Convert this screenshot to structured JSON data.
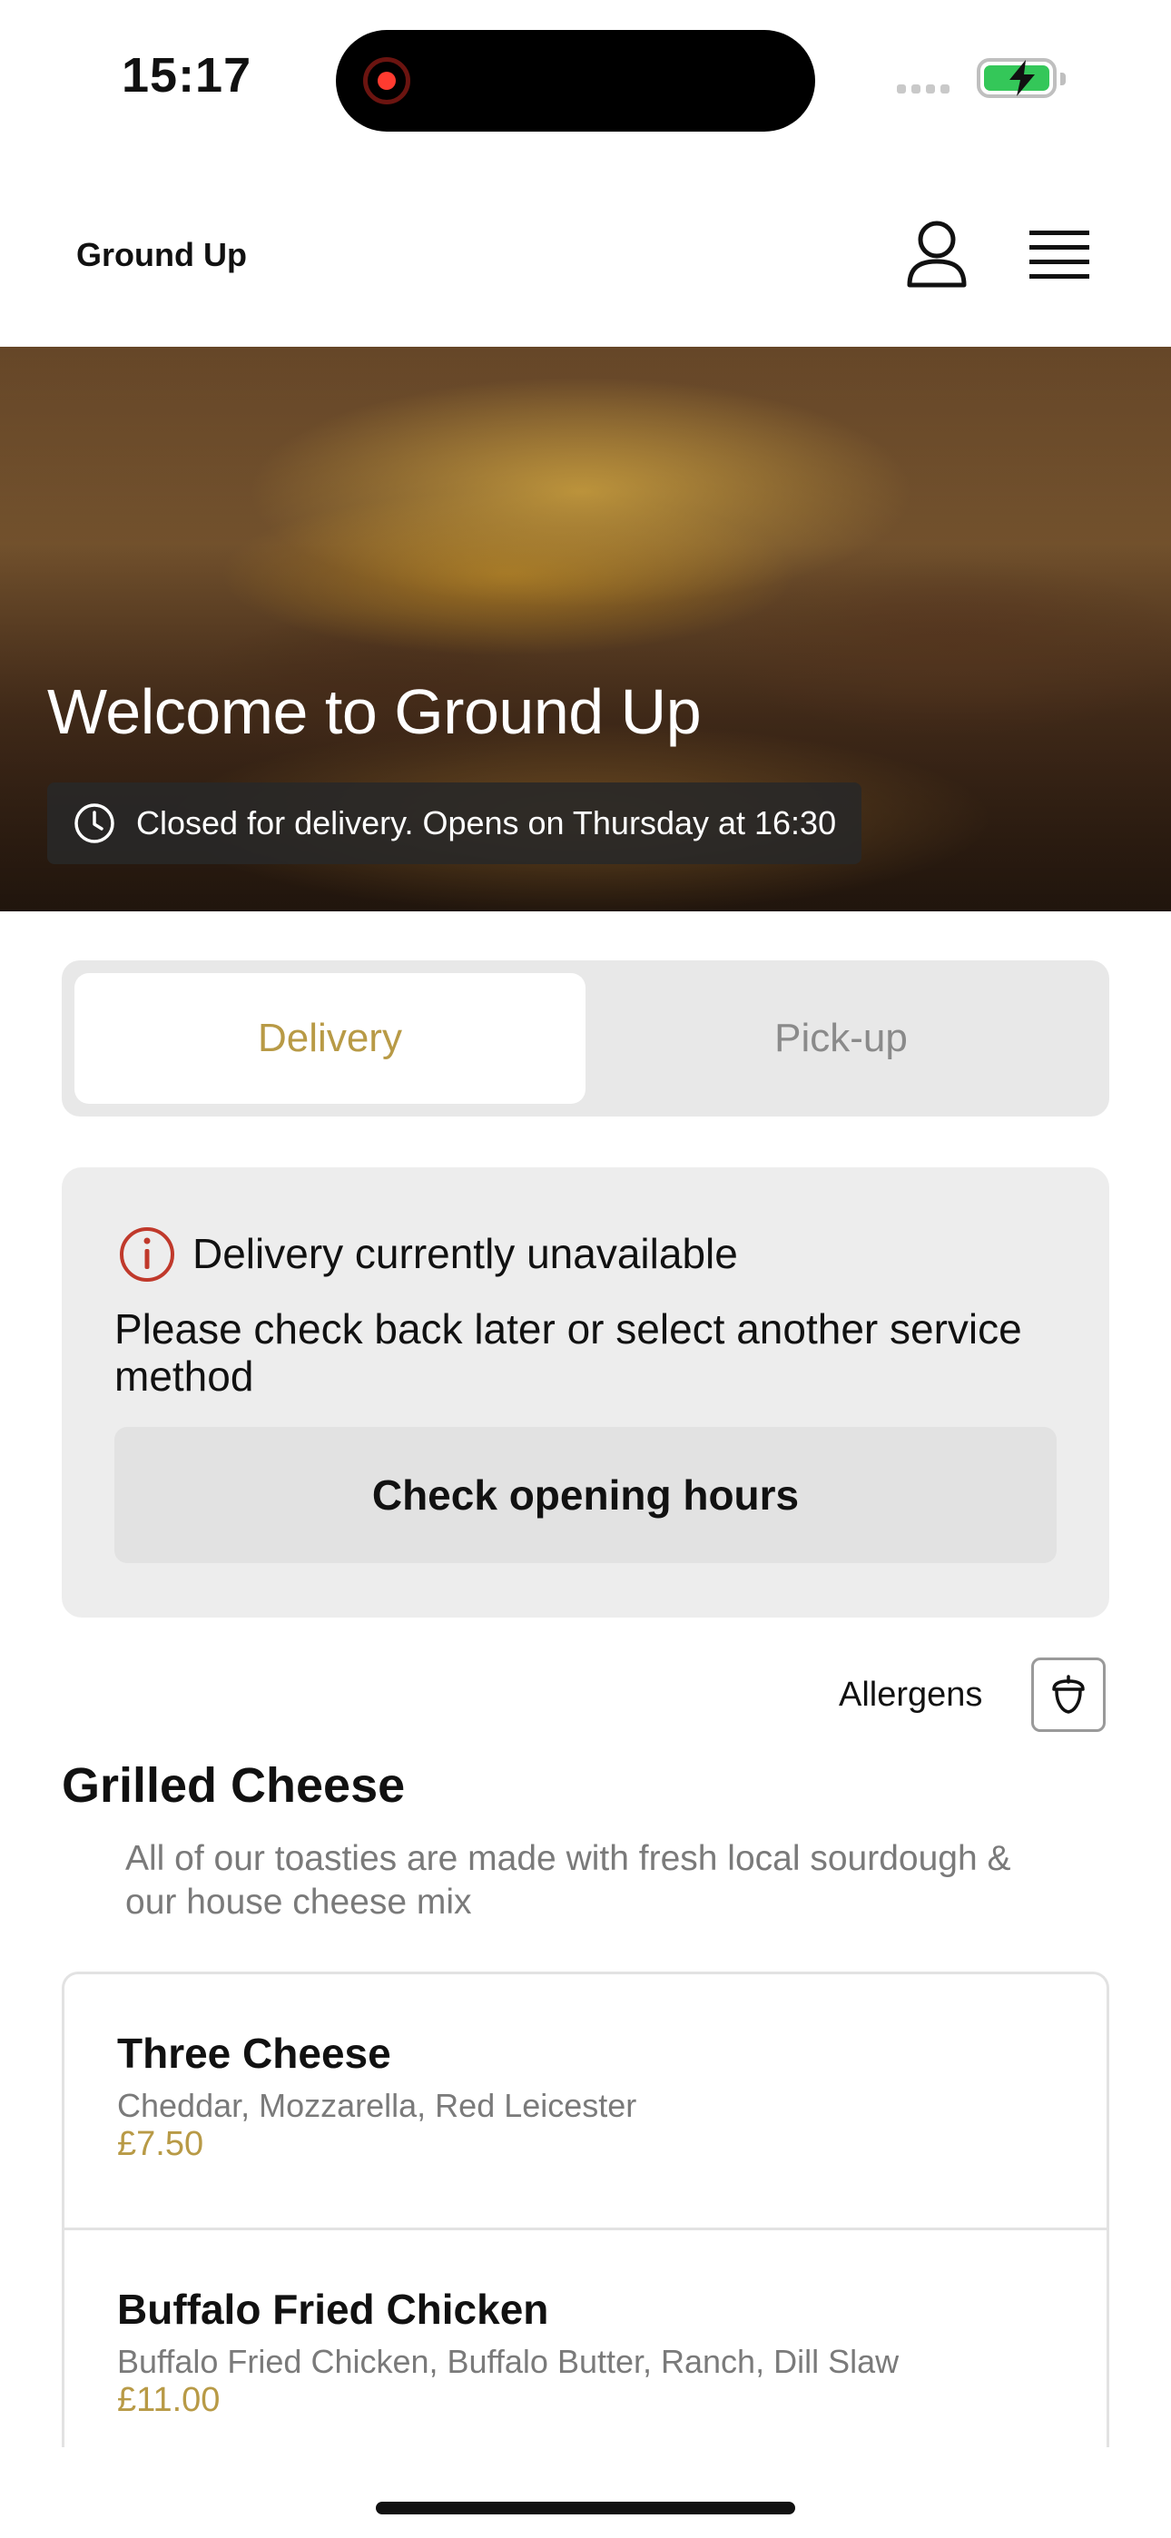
{
  "status_bar": {
    "time": "15:17"
  },
  "header": {
    "brand": "Ground Up",
    "icons": {
      "account": "user-icon",
      "menu": "hamburger-menu-icon"
    }
  },
  "hero": {
    "title": "Welcome to Ground Up",
    "status_text": "Closed for delivery. Opens on Thursday at 16:30",
    "status_icon": "clock-icon"
  },
  "service_toggle": {
    "options": [
      "Delivery",
      "Pick-up"
    ],
    "selected": "Delivery"
  },
  "notice": {
    "icon": "info-circle-icon",
    "title": "Delivery currently unavailable",
    "body": "Please check back later or select another service method",
    "button_label": "Check opening hours"
  },
  "allergens": {
    "label": "Allergens",
    "icon": "acorn-icon"
  },
  "section": {
    "title": "Grilled Cheese",
    "description": "All of our toasties are made with fresh local sourdough & our house cheese mix"
  },
  "items": [
    {
      "name": "Three Cheese",
      "description": "Cheddar, Mozzarella, Red Leicester",
      "price": "£7.50"
    },
    {
      "name": "Buffalo Fried Chicken",
      "description": "Buffalo Fried Chicken, Buffalo Butter, Ranch, Dill Slaw",
      "price": "£11.00"
    }
  ],
  "colors": {
    "accent_gold": "#b89a46",
    "error_red": "#c0392b",
    "battery_green": "#34c759"
  }
}
